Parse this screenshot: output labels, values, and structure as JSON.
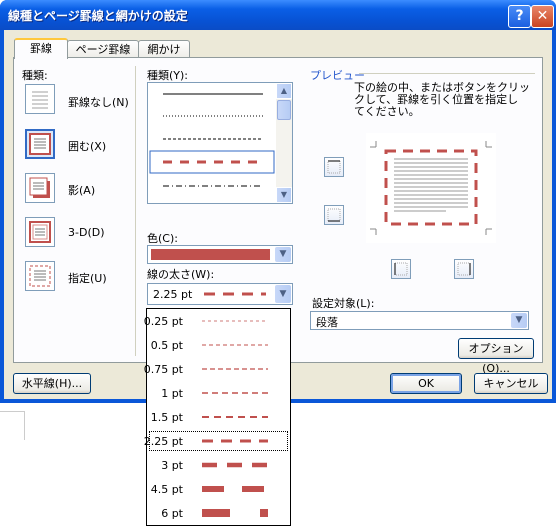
{
  "window": {
    "title": "線種とページ罫線と網かけの設定",
    "help_label": "?",
    "close_label": "✕"
  },
  "tabs": [
    {
      "label": "罫線"
    },
    {
      "label": "ページ罫線"
    },
    {
      "label": "網かけ"
    }
  ],
  "settings": {
    "heading": "種類:",
    "items": [
      {
        "label": "罫線なし(N)",
        "icon": "no-border-icon"
      },
      {
        "label": "囲む(X)",
        "icon": "box-border-icon"
      },
      {
        "label": "影(A)",
        "icon": "shadow-border-icon"
      },
      {
        "label": "3-D(D)",
        "icon": "3d-border-icon"
      },
      {
        "label": "指定(U)",
        "icon": "custom-border-icon"
      }
    ]
  },
  "style": {
    "heading": "種類(Y):",
    "color_label": "色(C):",
    "color_value": "#c0504d",
    "width_label": "線の太さ(W):",
    "width_value": "2.25 pt"
  },
  "preview": {
    "heading": "プレビュー",
    "instructions": [
      "下の絵の中、またはボタンをクリッ",
      "クして、罫線を引く位置を指定し",
      "てください。"
    ],
    "apply_to_label": "設定対象(L):",
    "apply_to_value": "段落",
    "options_label": "オプション(O)..."
  },
  "buttons": {
    "horizontal_line": "水平線(H)...",
    "ok": "OK",
    "cancel": "キャンセル"
  },
  "width_options": [
    "0.25 pt",
    "0.5 pt",
    "0.75 pt",
    "1 pt",
    "1.5 pt",
    "2.25 pt",
    "3 pt",
    "4.5 pt",
    "6 pt"
  ],
  "selected_width_index": 5,
  "colors": {
    "border": "#c0504d",
    "accent": "#316ac5"
  }
}
